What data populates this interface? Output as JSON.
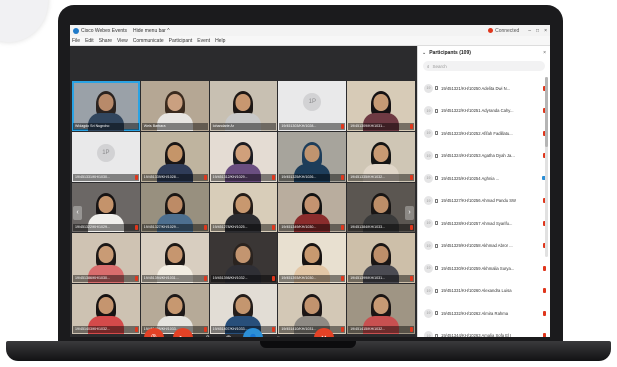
{
  "window": {
    "app_title": "Cisco Webex Events",
    "menu_toggle": "Hide menu bar ^",
    "connection_status": "Connected",
    "window_controls": [
      "–",
      "□",
      "×"
    ]
  },
  "menubar": {
    "items": [
      "File",
      "Edit",
      "Share",
      "View",
      "Communicate",
      "Participant",
      "Event",
      "Help"
    ]
  },
  "video_grid": {
    "tiles": [
      {
        "name": "Widagdo Sri Nugroho",
        "kind": "person",
        "skin": "#b88a6a",
        "hair": "#2a2320",
        "shirt": "#31465e",
        "bg": "#9aa1a8",
        "muted": false
      },
      {
        "name": "Weis Barbara",
        "kind": "person",
        "skin": "#caa080",
        "hair": "#3a2a1e",
        "shirt": "#e8e6e3",
        "bg": "#b5a794",
        "muted": false
      },
      {
        "name": "Iohandarie Ar",
        "kind": "person",
        "skin": "#c89770",
        "hair": "#1d1715",
        "shirt": "#c9c9c9",
        "bg": "#c8c0b2",
        "muted": false
      },
      {
        "name": "19/451303/KH/1028...",
        "kind": "placeholder",
        "initials": "1P",
        "muted": true
      },
      {
        "name": "19/451309/KH/1031...",
        "kind": "person",
        "skin": "#c69a75",
        "hair": "#151113",
        "shirt": "#6e3a43",
        "bg": "#d7cbb7",
        "muted": true
      },
      {
        "name": "19/451331/KH/1030...",
        "kind": "placeholder",
        "initials": "1P",
        "muted": true
      },
      {
        "name": "19/451339/KH/1028...",
        "kind": "person",
        "skin": "#c59569",
        "hair": "#1a1616",
        "shirt": "#2f3c58",
        "bg": "#bfb49f",
        "muted": true
      },
      {
        "name": "19/451312/KH/1029...",
        "kind": "person",
        "skin": "#d0a07b",
        "hair": "#1c1c22",
        "shirt": "#6a4e80",
        "bg": "#e4dcd3",
        "muted": true
      },
      {
        "name": "19/451325/KH/1026...",
        "kind": "person",
        "skin": "#c0946f",
        "hair": "#1d3d5a",
        "shirt": "#1d3d5a",
        "bg": "#a7a49c",
        "muted": true
      },
      {
        "name": "19/451335/KH/1032...",
        "kind": "person",
        "skin": "#c89a73",
        "hair": "#141414",
        "shirt": "#e0d6c8",
        "bg": "#cfc6b5",
        "muted": true
      },
      {
        "name": "19/451322/KH/1029...",
        "kind": "person",
        "skin": "#c4936b",
        "hair": "#161314",
        "shirt": "#f0efec",
        "bg": "#6b6765",
        "muted": true
      },
      {
        "name": "19/451327/KH/1029...",
        "kind": "person",
        "skin": "#bd8b66",
        "hair": "#1c1715",
        "shirt": "#4d6f8f",
        "bg": "#98907f",
        "muted": true
      },
      {
        "name": "19/451278/KH/1025...",
        "kind": "person",
        "skin": "#c8986f",
        "hair": "#241c18",
        "shirt": "#2c2c30",
        "bg": "#d8cdb9",
        "muted": true
      },
      {
        "name": "19/451349/KH/1030...",
        "kind": "person",
        "skin": "#c49370",
        "hair": "#121212",
        "shirt": "#8a2c2c",
        "bg": "#b9ad9e",
        "muted": true
      },
      {
        "name": "19/451384/KH/1033...",
        "kind": "person",
        "skin": "#bd8e68",
        "hair": "#181514",
        "shirt": "#3a3a3a",
        "bg": "#5b5651",
        "muted": true
      },
      {
        "name": "19/451386/KH/1030...",
        "kind": "person",
        "skin": "#c99b75",
        "hair": "#1b1716",
        "shirt": "#d96d6d",
        "bg": "#cfc3b3",
        "muted": true
      },
      {
        "name": "19/451394/KH/1031...",
        "kind": "person",
        "skin": "#c6966f",
        "hair": "#1d1815",
        "shirt": "#f2ede2",
        "bg": "#d8cec0",
        "muted": true
      },
      {
        "name": "19/451398/KH/1032...",
        "kind": "person",
        "skin": "#c39570",
        "hair": "#2a231f",
        "shirt": "#2f2f35",
        "bg": "#3a3635",
        "muted": true
      },
      {
        "name": "19/451393/KH/1030...",
        "kind": "person",
        "skin": "#c8996f",
        "hair": "#171312",
        "shirt": "#e3c7a6",
        "bg": "#e8e0d0",
        "muted": true
      },
      {
        "name": "19/451399/KH/1031...",
        "kind": "person",
        "skin": "#be8f6a",
        "hair": "#1a1615",
        "shirt": "#4b4b52",
        "bg": "#cdbfa9",
        "muted": true
      },
      {
        "name": "19/451403/KH/1032...",
        "kind": "person",
        "skin": "#c5956f",
        "hair": "#161212",
        "shirt": "#d44a4a",
        "bg": "#cdc2b2",
        "muted": true
      },
      {
        "name": "19/451406/KH/1033...",
        "kind": "person",
        "skin": "#c79870",
        "hair": "#1e1918",
        "shirt": "#e6e4df",
        "bg": "#b6aa98",
        "muted": true
      },
      {
        "name": "19/451407/KH/1033...",
        "kind": "person",
        "skin": "#c4966f",
        "hair": "#241d1a",
        "shirt": "#284f7a",
        "bg": "#e2ddd5",
        "muted": true
      },
      {
        "name": "19/451410/KH/1031...",
        "kind": "person",
        "skin": "#c2936e",
        "hair": "#1b1616",
        "shirt": "#8e8a84",
        "bg": "#d3c8b6",
        "muted": true
      },
      {
        "name": "19/451415/KH/1032...",
        "kind": "person",
        "skin": "#c89a74",
        "hair": "#1a1514",
        "shirt": "#c85050",
        "bg": "#9f9584",
        "muted": true
      }
    ]
  },
  "controls": {
    "buttons": [
      {
        "name": "mute-button",
        "icon": "microphone-off-icon",
        "glyph": "🎙",
        "style": "red"
      },
      {
        "name": "stop-video-button",
        "icon": "video-off-icon",
        "glyph": "▶",
        "style": "red"
      },
      {
        "name": "share-button",
        "icon": "share-icon",
        "glyph": "⇪",
        "style": "plain"
      },
      {
        "name": "record-button",
        "icon": "record-icon",
        "glyph": "◉",
        "style": "plain"
      },
      {
        "name": "participants-button",
        "icon": "participants-icon",
        "glyph": "👤",
        "style": "blue"
      },
      {
        "name": "chat-button",
        "icon": "chat-icon",
        "glyph": "◌",
        "style": "plain"
      },
      {
        "name": "more-button",
        "icon": "more-icon",
        "glyph": "⋯",
        "style": "plain"
      },
      {
        "name": "leave-button",
        "icon": "close-icon",
        "glyph": "✕",
        "style": "red"
      }
    ]
  },
  "participants_panel": {
    "title": "Participants (109)",
    "search_placeholder": "Search",
    "rows": [
      {
        "initials": "19",
        "name": "19/451321/KH/10250 Adelita Dwi N...",
        "status": "mic"
      },
      {
        "initials": "19",
        "name": "19/451322/KH/10251 Adyranda Cahy...",
        "status": "mic"
      },
      {
        "initials": "19",
        "name": "19/451323/KH/10252 Afifah Fadillatu...",
        "status": "mic"
      },
      {
        "initials": "19",
        "name": "19/451324/KH/10253 Agatha Dyah Ja...",
        "status": "mic"
      },
      {
        "initials": "19",
        "name": "19/451325/KH/10254 Aghnia ...",
        "status": "cam"
      },
      {
        "initials": "19",
        "name": "19/451327/KH/10256 Ahmad Pandu SW",
        "status": "mic"
      },
      {
        "initials": "19",
        "name": "19/451328/KH/10257 Ahmad Syarifu...",
        "status": "mic"
      },
      {
        "initials": "19",
        "name": "19/451329/KH/10258 Akhmad Abror ...",
        "status": "mic"
      },
      {
        "initials": "19",
        "name": "19/451330/KH/10259 Akhmalia Surya...",
        "status": "mic"
      },
      {
        "initials": "19",
        "name": "19/451331/KH/10260 Alexandra Luisa",
        "status": "mic"
      },
      {
        "initials": "19",
        "name": "19/451332/KH/10262 Almira Rahma",
        "status": "mic"
      },
      {
        "initials": "19",
        "name": "19/451344/KH/10263 Amalia Sofa El I",
        "status": "mic"
      }
    ]
  }
}
